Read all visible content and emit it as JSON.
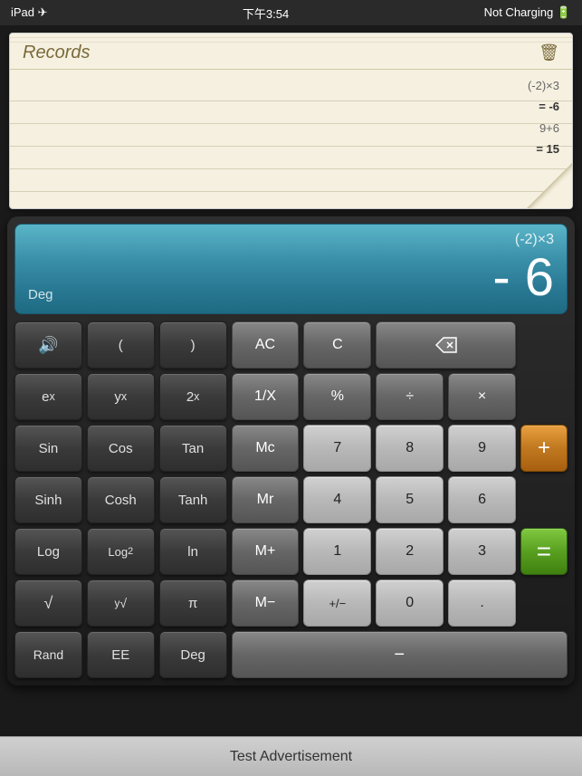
{
  "statusBar": {
    "left": "iPad ✈",
    "center": "下午3:54",
    "right": "Not Charging 🔋"
  },
  "records": {
    "title": "Records",
    "entries": [
      {
        "expr": "(-2)×3",
        "result": "= -6"
      },
      {
        "expr": "9+6",
        "result": "= 15"
      }
    ],
    "deleteIcon": "🗑"
  },
  "display": {
    "expression": "(-2)×3",
    "result": "- 6",
    "mode": "Deg"
  },
  "buttons": {
    "row1": [
      {
        "label": "🔊",
        "type": "dark",
        "name": "sound-button"
      },
      {
        "label": "(",
        "type": "dark",
        "name": "open-paren-button"
      },
      {
        "label": ")",
        "type": "dark",
        "name": "close-paren-button"
      },
      {
        "label": "AC",
        "type": "med",
        "name": "ac-button"
      },
      {
        "label": "C",
        "type": "med",
        "name": "c-button"
      },
      {
        "label": "⌫",
        "type": "med",
        "name": "backspace-button",
        "span": 1
      }
    ],
    "row2": [
      {
        "label": "eˣ",
        "type": "dark",
        "name": "ex-button"
      },
      {
        "label": "yˣ",
        "type": "dark",
        "name": "yx-button"
      },
      {
        "label": "2ˣ",
        "type": "dark",
        "name": "2x-button"
      },
      {
        "label": "1/X",
        "type": "med",
        "name": "reciprocal-button"
      },
      {
        "label": "%",
        "type": "med",
        "name": "percent-button"
      },
      {
        "label": "÷",
        "type": "med",
        "name": "divide-button"
      },
      {
        "label": "×",
        "type": "med",
        "name": "multiply-button"
      }
    ],
    "row3": [
      {
        "label": "Sin",
        "type": "dark",
        "name": "sin-button"
      },
      {
        "label": "Cos",
        "type": "dark",
        "name": "cos-button"
      },
      {
        "label": "Tan",
        "type": "dark",
        "name": "tan-button"
      },
      {
        "label": "Mc",
        "type": "med",
        "name": "mc-button"
      },
      {
        "label": "7",
        "type": "light",
        "name": "seven-button"
      },
      {
        "label": "8",
        "type": "light",
        "name": "eight-button"
      },
      {
        "label": "9",
        "type": "light",
        "name": "nine-button"
      }
    ],
    "row4": [
      {
        "label": "Sinh",
        "type": "dark",
        "name": "sinh-button"
      },
      {
        "label": "Cosh",
        "type": "dark",
        "name": "cosh-button"
      },
      {
        "label": "Tanh",
        "type": "dark",
        "name": "tanh-button"
      },
      {
        "label": "Mr",
        "type": "med",
        "name": "mr-button"
      },
      {
        "label": "4",
        "type": "light",
        "name": "four-button"
      },
      {
        "label": "5",
        "type": "light",
        "name": "five-button"
      },
      {
        "label": "6",
        "type": "light",
        "name": "six-button"
      }
    ],
    "row5": [
      {
        "label": "Log",
        "type": "dark",
        "name": "log-button"
      },
      {
        "label": "Log₂",
        "type": "dark",
        "name": "log2-button"
      },
      {
        "label": "ln",
        "type": "dark",
        "name": "ln-button"
      },
      {
        "label": "M+",
        "type": "med",
        "name": "mplus-button"
      },
      {
        "label": "1",
        "type": "light",
        "name": "one-button"
      },
      {
        "label": "2",
        "type": "light",
        "name": "two-button"
      },
      {
        "label": "3",
        "type": "light",
        "name": "three-button"
      }
    ],
    "row6": [
      {
        "label": "√—",
        "type": "dark",
        "name": "sqrt-button"
      },
      {
        "label": "√y",
        "type": "dark",
        "name": "sqrty-button"
      },
      {
        "label": "π",
        "type": "dark",
        "name": "pi-button"
      },
      {
        "label": "M−",
        "type": "med",
        "name": "mminus-button"
      },
      {
        "label": "+/−",
        "type": "light",
        "name": "plusminus-button"
      },
      {
        "label": "0",
        "type": "light",
        "name": "zero-button"
      },
      {
        "label": ".",
        "type": "light",
        "name": "decimal-button"
      }
    ],
    "row7": [
      {
        "label": "Rand",
        "type": "dark",
        "name": "rand-button"
      },
      {
        "label": "EE",
        "type": "dark",
        "name": "ee-button"
      },
      {
        "label": "Deg",
        "type": "dark",
        "name": "deg-button"
      },
      {
        "label": "−",
        "type": "med",
        "name": "minus-button"
      }
    ],
    "plusLabel": "+",
    "equalsLabel": "="
  },
  "adBar": {
    "label": "Test Advertisement"
  }
}
